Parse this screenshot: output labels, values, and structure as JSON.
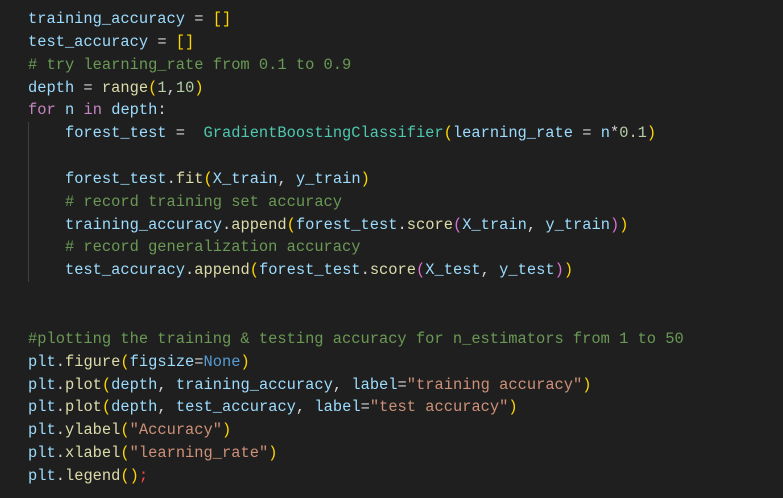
{
  "code": {
    "lines": [
      {
        "indent": false,
        "tokens": [
          [
            "training_accuracy",
            "var"
          ],
          [
            " = ",
            "plain"
          ],
          [
            "[]",
            "b1"
          ]
        ]
      },
      {
        "indent": false,
        "tokens": [
          [
            "test_accuracy",
            "var"
          ],
          [
            " = ",
            "plain"
          ],
          [
            "[]",
            "b1"
          ]
        ]
      },
      {
        "indent": false,
        "tokens": [
          [
            "# try learning_rate from 0.1 to 0.9",
            "comment"
          ]
        ]
      },
      {
        "indent": false,
        "tokens": [
          [
            "depth",
            "var"
          ],
          [
            " = ",
            "plain"
          ],
          [
            "range",
            "fn"
          ],
          [
            "(",
            "b1"
          ],
          [
            "1",
            "num"
          ],
          [
            ",",
            "plain"
          ],
          [
            "10",
            "num"
          ],
          [
            ")",
            "b1"
          ]
        ]
      },
      {
        "indent": false,
        "tokens": [
          [
            "for",
            "kw"
          ],
          [
            " ",
            "plain"
          ],
          [
            "n",
            "var"
          ],
          [
            " ",
            "plain"
          ],
          [
            "in",
            "kw"
          ],
          [
            " ",
            "plain"
          ],
          [
            "depth",
            "var"
          ],
          [
            ":",
            "plain"
          ]
        ]
      },
      {
        "indent": true,
        "tokens": [
          [
            "    ",
            "plain"
          ],
          [
            "forest_test",
            "var"
          ],
          [
            " =  ",
            "plain"
          ],
          [
            "GradientBoostingClassifier",
            "cls"
          ],
          [
            "(",
            "b1"
          ],
          [
            "learning_rate",
            "var"
          ],
          [
            " = ",
            "plain"
          ],
          [
            "n",
            "var"
          ],
          [
            "*",
            "plain"
          ],
          [
            "0.1",
            "num"
          ],
          [
            ")",
            "b1"
          ]
        ]
      },
      {
        "indent": true,
        "tokens": []
      },
      {
        "indent": true,
        "tokens": [
          [
            "    ",
            "plain"
          ],
          [
            "forest_test",
            "var"
          ],
          [
            ".",
            "plain"
          ],
          [
            "fit",
            "fn"
          ],
          [
            "(",
            "b1"
          ],
          [
            "X_train",
            "var"
          ],
          [
            ", ",
            "plain"
          ],
          [
            "y_train",
            "var"
          ],
          [
            ")",
            "b1"
          ]
        ]
      },
      {
        "indent": true,
        "tokens": [
          [
            "    ",
            "plain"
          ],
          [
            "# record training set accuracy",
            "comment"
          ]
        ]
      },
      {
        "indent": true,
        "tokens": [
          [
            "    ",
            "plain"
          ],
          [
            "training_accuracy",
            "var"
          ],
          [
            ".",
            "plain"
          ],
          [
            "append",
            "fn"
          ],
          [
            "(",
            "b1"
          ],
          [
            "forest_test",
            "var"
          ],
          [
            ".",
            "plain"
          ],
          [
            "score",
            "fn"
          ],
          [
            "(",
            "b2"
          ],
          [
            "X_train",
            "var"
          ],
          [
            ", ",
            "plain"
          ],
          [
            "y_train",
            "var"
          ],
          [
            ")",
            "b2"
          ],
          [
            ")",
            "b1"
          ]
        ]
      },
      {
        "indent": true,
        "tokens": [
          [
            "    ",
            "plain"
          ],
          [
            "# record generalization accuracy",
            "comment"
          ]
        ]
      },
      {
        "indent": true,
        "tokens": [
          [
            "    ",
            "plain"
          ],
          [
            "test_accuracy",
            "var"
          ],
          [
            ".",
            "plain"
          ],
          [
            "append",
            "fn"
          ],
          [
            "(",
            "b1"
          ],
          [
            "forest_test",
            "var"
          ],
          [
            ".",
            "plain"
          ],
          [
            "score",
            "fn"
          ],
          [
            "(",
            "b2"
          ],
          [
            "X_test",
            "var"
          ],
          [
            ", ",
            "plain"
          ],
          [
            "y_test",
            "var"
          ],
          [
            ")",
            "b2"
          ],
          [
            ")",
            "b1"
          ]
        ]
      },
      {
        "indent": false,
        "tokens": []
      },
      {
        "indent": false,
        "tokens": []
      },
      {
        "indent": false,
        "tokens": [
          [
            "#plotting the training & testing accuracy for n_estimators from 1 to 50",
            "comment"
          ]
        ]
      },
      {
        "indent": false,
        "tokens": [
          [
            "plt",
            "var"
          ],
          [
            ".",
            "plain"
          ],
          [
            "figure",
            "fn"
          ],
          [
            "(",
            "b1"
          ],
          [
            "figsize",
            "var"
          ],
          [
            "=",
            "plain"
          ],
          [
            "None",
            "const"
          ],
          [
            ")",
            "b1"
          ]
        ]
      },
      {
        "indent": false,
        "tokens": [
          [
            "plt",
            "var"
          ],
          [
            ".",
            "plain"
          ],
          [
            "plot",
            "fn"
          ],
          [
            "(",
            "b1"
          ],
          [
            "depth",
            "var"
          ],
          [
            ", ",
            "plain"
          ],
          [
            "training_accuracy",
            "var"
          ],
          [
            ", ",
            "plain"
          ],
          [
            "label",
            "var"
          ],
          [
            "=",
            "plain"
          ],
          [
            "\"training accuracy\"",
            "str"
          ],
          [
            ")",
            "b1"
          ]
        ]
      },
      {
        "indent": false,
        "tokens": [
          [
            "plt",
            "var"
          ],
          [
            ".",
            "plain"
          ],
          [
            "plot",
            "fn"
          ],
          [
            "(",
            "b1"
          ],
          [
            "depth",
            "var"
          ],
          [
            ", ",
            "plain"
          ],
          [
            "test_accuracy",
            "var"
          ],
          [
            ", ",
            "plain"
          ],
          [
            "label",
            "var"
          ],
          [
            "=",
            "plain"
          ],
          [
            "\"test accuracy\"",
            "str"
          ],
          [
            ")",
            "b1"
          ]
        ]
      },
      {
        "indent": false,
        "tokens": [
          [
            "plt",
            "var"
          ],
          [
            ".",
            "plain"
          ],
          [
            "ylabel",
            "fn"
          ],
          [
            "(",
            "b1"
          ],
          [
            "\"Accuracy\"",
            "str"
          ],
          [
            ")",
            "b1"
          ]
        ]
      },
      {
        "indent": false,
        "tokens": [
          [
            "plt",
            "var"
          ],
          [
            ".",
            "plain"
          ],
          [
            "xlabel",
            "fn"
          ],
          [
            "(",
            "b1"
          ],
          [
            "\"learning_rate\"",
            "str"
          ],
          [
            ")",
            "b1"
          ]
        ]
      },
      {
        "indent": false,
        "tokens": [
          [
            "plt",
            "var"
          ],
          [
            ".",
            "plain"
          ],
          [
            "legend",
            "fn"
          ],
          [
            "()",
            "b1"
          ],
          [
            ";",
            "err"
          ]
        ]
      }
    ]
  }
}
